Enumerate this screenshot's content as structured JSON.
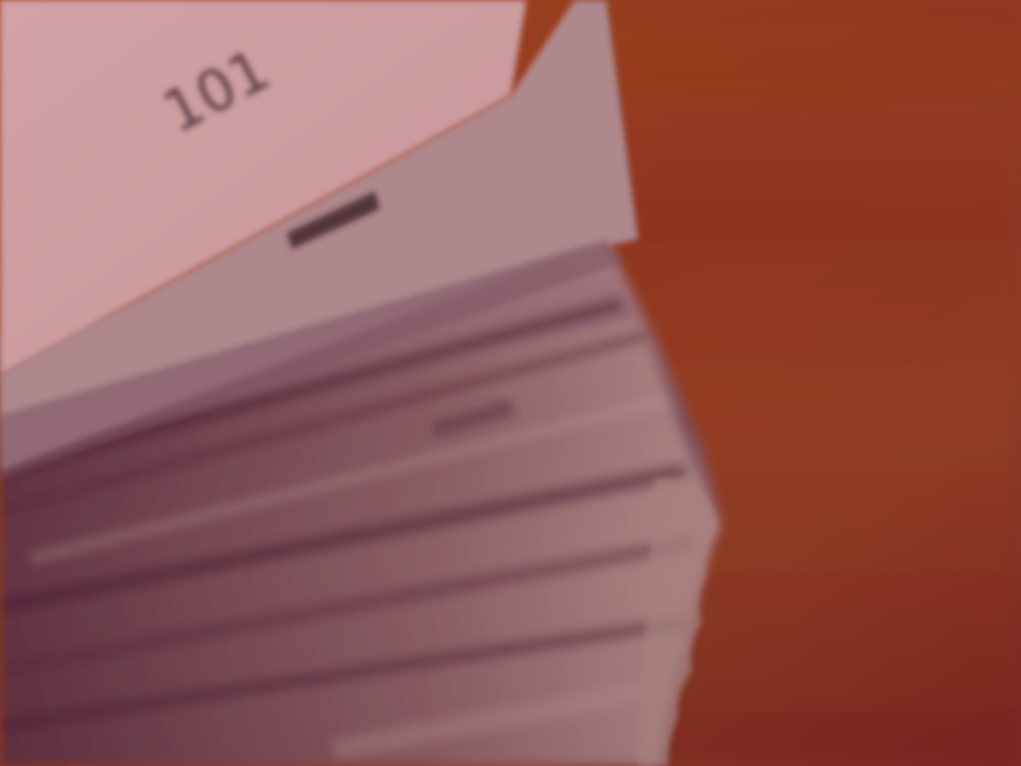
{
  "scene": {
    "description_kind": "photo",
    "page_numbers": [
      "101"
    ],
    "colors": {
      "wood_light": "#a2461f",
      "wood_dark": "#7e2920",
      "page_top": "#cc9c9f",
      "page_shadow": "#5a2638",
      "page_mid": "#a47a7e",
      "page_edge": "#b88a88"
    }
  }
}
